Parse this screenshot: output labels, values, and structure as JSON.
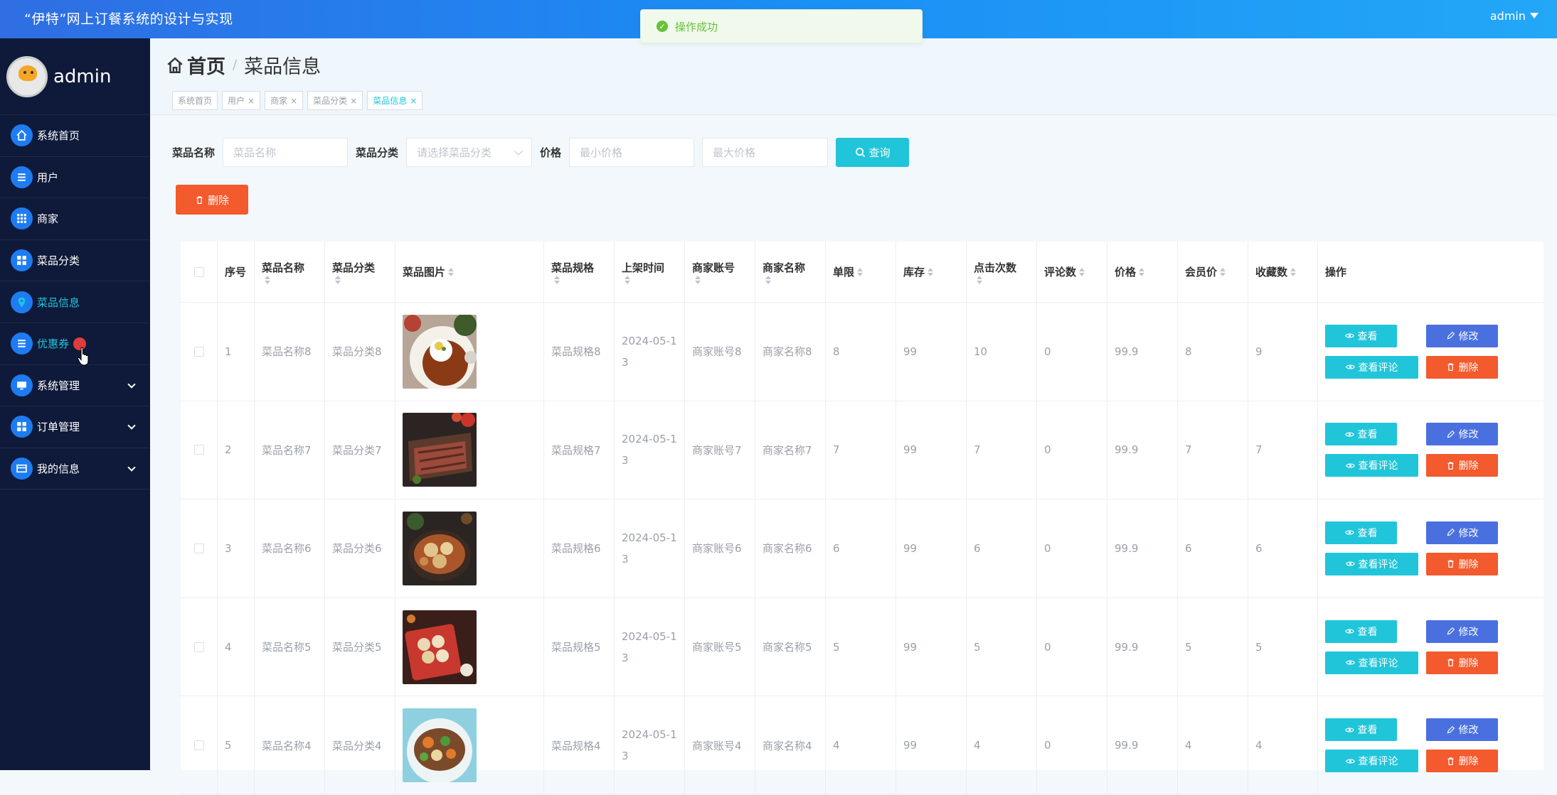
{
  "app": {
    "title": "“伊特”网上订餐系统的设计与实现",
    "user": "admin"
  },
  "toast": {
    "message": "操作成功"
  },
  "sidebar": {
    "profile_name": "admin",
    "items": [
      {
        "label": "系统首页",
        "icon": "home-icon"
      },
      {
        "label": "用户",
        "icon": "list-icon"
      },
      {
        "label": "商家",
        "icon": "grid-icon"
      },
      {
        "label": "菜品分类",
        "icon": "category-icon"
      },
      {
        "label": "菜品信息",
        "icon": "location-icon"
      },
      {
        "label": "优惠券",
        "icon": "list-icon"
      },
      {
        "label": "系统管理",
        "icon": "monitor-icon"
      },
      {
        "label": "订单管理",
        "icon": "grid-icon"
      },
      {
        "label": "我的信息",
        "icon": "card-icon"
      }
    ]
  },
  "header": {
    "home": "首页",
    "current": "菜品信息",
    "tabs": [
      "系统首页",
      "用户",
      "商家",
      "菜品分类",
      "菜品信息"
    ]
  },
  "search": {
    "name_label": "菜品名称",
    "name_placeholder": "菜品名称",
    "category_label": "菜品分类",
    "category_placeholder": "请选择菜品分类",
    "price_label": "价格",
    "min_placeholder": "最小价格",
    "max_placeholder": "最大价格",
    "query_button": "查询"
  },
  "toolbar": {
    "delete_label": "删除"
  },
  "table": {
    "headers": [
      "序号",
      "菜品名称",
      "菜品分类",
      "菜品图片",
      "菜品规格",
      "上架时间",
      "商家账号",
      "商家名称",
      "单限",
      "库存",
      "点击次数",
      "评论数",
      "价格",
      "会员价",
      "收藏数",
      "操作"
    ],
    "actions": {
      "view": "查看",
      "edit": "修改",
      "comments": "查看评论",
      "delete": "删除"
    },
    "rows": [
      {
        "no": "1",
        "name": "菜品名称8",
        "category": "菜品分类8",
        "spec": "菜品规格8",
        "time_1": "2024-05-1",
        "time_2": "3",
        "account": "商家账号8",
        "shop": "商家名称8",
        "limit": "8",
        "stock": "99",
        "clicks": "10",
        "comments": "0",
        "price": "99.9",
        "member_price": "8",
        "favorites": "9"
      },
      {
        "no": "2",
        "name": "菜品名称7",
        "category": "菜品分类7",
        "spec": "菜品规格7",
        "time_1": "2024-05-1",
        "time_2": "3",
        "account": "商家账号7",
        "shop": "商家名称7",
        "limit": "7",
        "stock": "99",
        "clicks": "7",
        "comments": "0",
        "price": "99.9",
        "member_price": "7",
        "favorites": "7"
      },
      {
        "no": "3",
        "name": "菜品名称6",
        "category": "菜品分类6",
        "spec": "菜品规格6",
        "time_1": "2024-05-1",
        "time_2": "3",
        "account": "商家账号6",
        "shop": "商家名称6",
        "limit": "6",
        "stock": "99",
        "clicks": "6",
        "comments": "0",
        "price": "99.9",
        "member_price": "6",
        "favorites": "6"
      },
      {
        "no": "4",
        "name": "菜品名称5",
        "category": "菜品分类5",
        "spec": "菜品规格5",
        "time_1": "2024-05-1",
        "time_2": "3",
        "account": "商家账号5",
        "shop": "商家名称5",
        "limit": "5",
        "stock": "99",
        "clicks": "5",
        "comments": "0",
        "price": "99.9",
        "member_price": "5",
        "favorites": "5"
      },
      {
        "no": "5",
        "name": "菜品名称4",
        "category": "菜品分类4",
        "spec": "菜品规格4",
        "time_1": "2024-05-1",
        "time_2": "3",
        "account": "商家账号4",
        "shop": "商家名称4",
        "limit": "4",
        "stock": "99",
        "clicks": "4",
        "comments": "0",
        "price": "99.9",
        "member_price": "4",
        "favorites": "4"
      }
    ]
  },
  "colors": {
    "accent": "#21c5d9",
    "primary": "#1d7cf2",
    "edit": "#4a70e0",
    "danger": "#f35a2d",
    "sidebar": "#0f1a3a"
  }
}
